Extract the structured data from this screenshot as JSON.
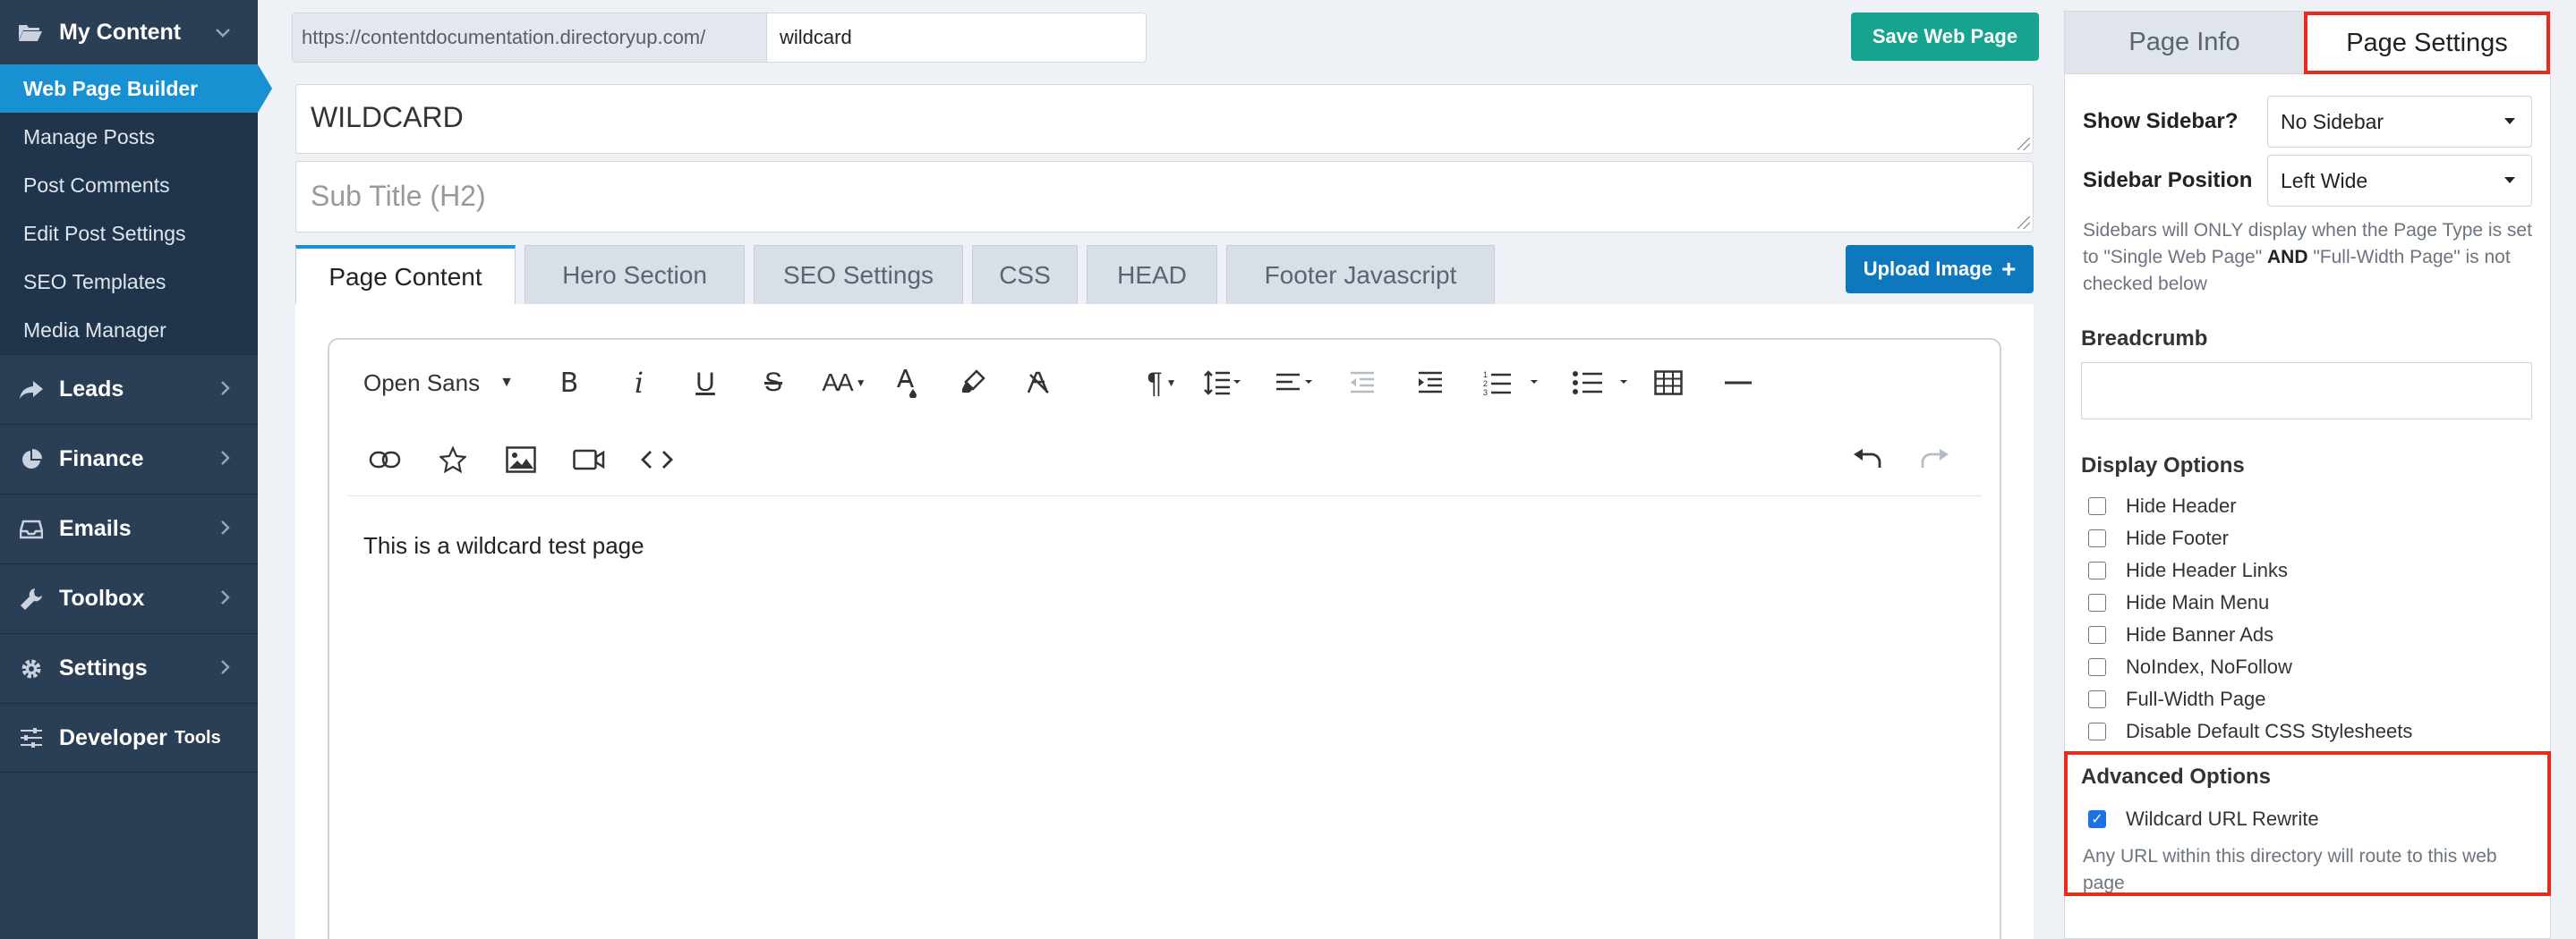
{
  "sidebar": {
    "my_content": "My Content",
    "sub_items": [
      "Web Page Builder",
      "Manage Posts",
      "Post Comments",
      "Edit Post Settings",
      "SEO Templates",
      "Media Manager"
    ],
    "sections": {
      "leads": "Leads",
      "finance": "Finance",
      "emails": "Emails",
      "toolbox": "Toolbox",
      "settings": "Settings",
      "developer": "Developer",
      "developer_small": "Tools"
    }
  },
  "url": {
    "prefix": "https://contentdocumentation.directoryup.com/",
    "slug": "wildcard"
  },
  "save_button": "Save Web Page",
  "title": "WILDCARD",
  "subtitle_placeholder": "Sub Title (H2)",
  "tabs": [
    "Page Content",
    "Hero Section",
    "SEO Settings",
    "CSS",
    "HEAD",
    "Footer Javascript"
  ],
  "upload_button": "Upload Image",
  "editor": {
    "font": "Open Sans",
    "content": "This is a wildcard test page",
    "tools": {
      "bold": "B",
      "italic": "i",
      "underline": "U",
      "strike": "S",
      "font_size": "AA",
      "paragraph": "¶"
    }
  },
  "right_panel": {
    "tabs": [
      "Page Info",
      "Page Settings"
    ],
    "show_sidebar_label": "Show Sidebar?",
    "show_sidebar_value": "No Sidebar",
    "sidebar_position_label": "Sidebar Position",
    "sidebar_position_value": "Left Wide",
    "note_part1": "Sidebars will ONLY display when the Page Type is set to \"Single Web Page\"",
    "note_and": "AND",
    "note_part2": "\"Full-Width Page\" is not checked below",
    "breadcrumb_label": "Breadcrumb",
    "display_options_label": "Display Options",
    "display_options": [
      "Hide Header",
      "Hide Footer",
      "Hide Header Links",
      "Hide Main Menu",
      "Hide Banner Ads",
      "NoIndex, NoFollow",
      "Full-Width Page",
      "Disable Default CSS Stylesheets"
    ],
    "advanced_label": "Advanced Options",
    "wildcard_label": "Wildcard URL Rewrite",
    "wildcard_checked": true,
    "wildcard_note": "Any URL within this directory will route to this web page"
  },
  "colors": {
    "sidebar_bg": "#2a3e55",
    "active_blue": "#1791d2",
    "save_green": "#16a38f",
    "highlight_red": "#e42d1e"
  }
}
